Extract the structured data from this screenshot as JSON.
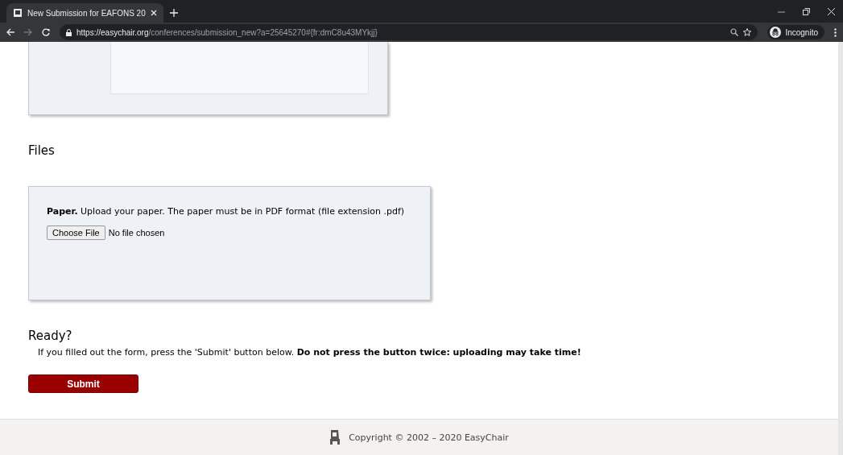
{
  "browser": {
    "tab_title": "New Submission for EAFONS 20",
    "url_host": "https://easychair.org",
    "url_path": "/conferences/submission_new?a=25645270#{fr:dmC8u43MYkjj}",
    "profile": "Incognito"
  },
  "files": {
    "heading": "Files",
    "description": "**Paper.** Upload your paper. The paper must be in PDF format (file extension .pdf)",
    "choose_button": "Choose File",
    "file_status": "No file chosen"
  },
  "ready": {
    "heading": "Ready?",
    "instructions": "If you filled out the form, press the 'Submit' button below. **Do not press the button twice: uploading may take time!**",
    "submit": "Submit"
  },
  "footer": {
    "copyright": "Copyright © 2002 – 2020 EasyChair"
  }
}
